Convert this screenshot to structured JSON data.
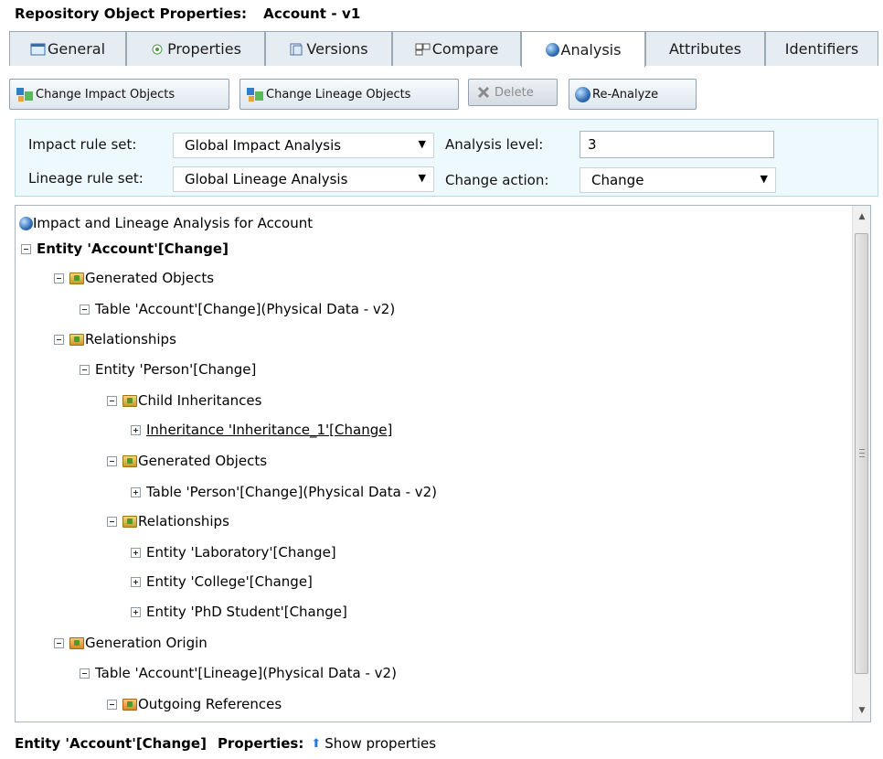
{
  "header": {
    "label": "Repository Object Properties:",
    "object": "Account - v1"
  },
  "tabs": [
    {
      "label": "General",
      "icon": "general-icon"
    },
    {
      "label": "Properties",
      "icon": "properties-icon"
    },
    {
      "label": "Versions",
      "icon": "versions-icon"
    },
    {
      "label": "Compare",
      "icon": "compare-icon"
    },
    {
      "label": "Analysis",
      "icon": "globe-icon"
    },
    {
      "label": "Attributes"
    },
    {
      "label": "Identifiers"
    }
  ],
  "active_tab": "Analysis",
  "toolbar": {
    "change_impact": "Change Impact Objects",
    "change_lineage": "Change Lineage Objects",
    "delete": "Delete",
    "reanalyze": "Re-Analyze"
  },
  "settings": {
    "impact_rule_label": "Impact rule set:",
    "impact_rule_value": "Global Impact Analysis",
    "lineage_rule_label": "Lineage rule set:",
    "lineage_rule_value": "Global Lineage Analysis",
    "analysis_level_label": "Analysis level:",
    "analysis_level_value": "3",
    "change_action_label": "Change action:",
    "change_action_value": "Change"
  },
  "tree": {
    "root": "Impact and Lineage Analysis for Account",
    "nodes": [
      "Entity 'Account'[Change]",
      "Generated Objects",
      "Table 'Account'[Change](Physical Data - v2)",
      "Relationships",
      "Entity 'Person'[Change]",
      "Child Inheritances",
      "Inheritance 'Inheritance_1'[Change]",
      "Generated Objects",
      "Table 'Person'[Change](Physical Data - v2)",
      "Relationships",
      "Entity 'Laboratory'[Change]",
      "Entity 'College'[Change]",
      "Entity 'PhD Student'[Change]",
      "Generation Origin",
      "Table 'Account'[Lineage](Physical Data - v2)",
      "Outgoing References"
    ]
  },
  "footer": {
    "selected": "Entity 'Account'[Change]",
    "properties_label": "Properties:",
    "show_properties": "Show properties"
  }
}
